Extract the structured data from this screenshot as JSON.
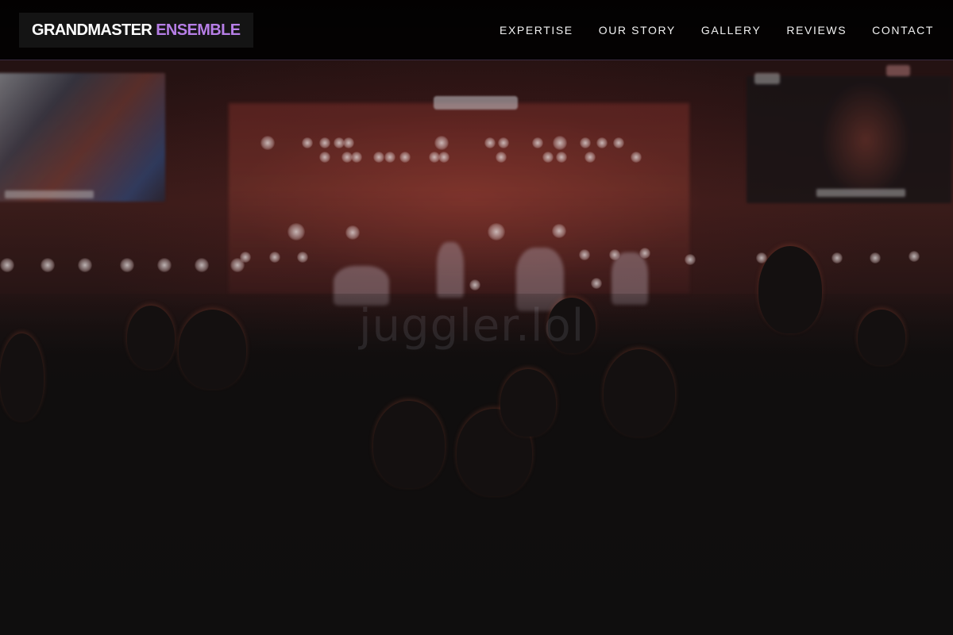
{
  "brand": {
    "name_primary": "GRANDMASTER",
    "name_accent": "ENSEMBLE",
    "accent_color": "#b67ee6"
  },
  "nav": {
    "items": [
      {
        "label": "EXPERTISE"
      },
      {
        "label": "OUR STORY"
      },
      {
        "label": "GALLERY"
      },
      {
        "label": "REVIEWS"
      },
      {
        "label": "CONTACT"
      }
    ]
  },
  "hero": {
    "watermark": "juggler.lol"
  }
}
